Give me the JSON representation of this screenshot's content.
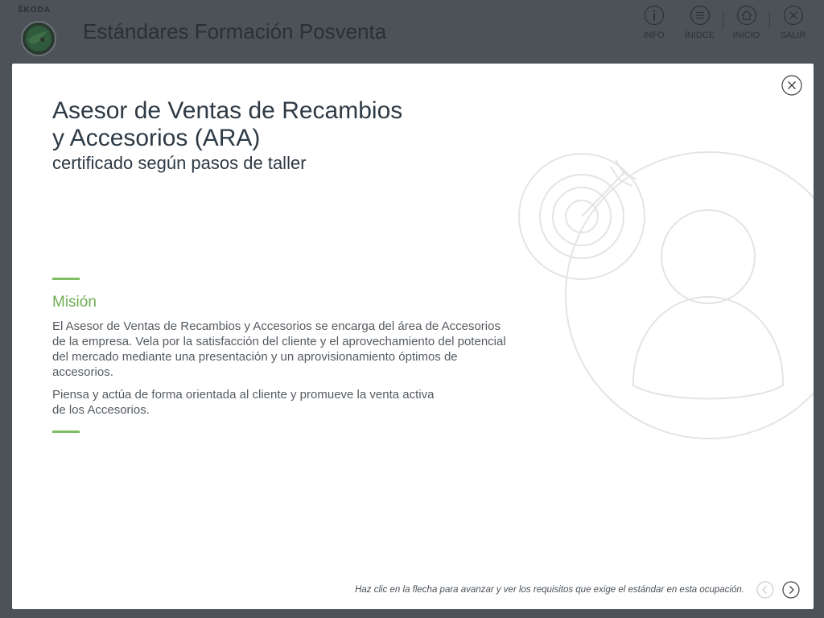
{
  "header": {
    "brand": "ŠKODA",
    "app_title": "Estándares Formación Posventa",
    "nav": [
      {
        "label": "INFO",
        "icon": "info-icon"
      },
      {
        "label": "ÍNIDCE",
        "icon": "list-icon"
      },
      {
        "label": "INICIO",
        "icon": "home-icon"
      },
      {
        "label": "SALIR",
        "icon": "close-icon"
      }
    ]
  },
  "modal": {
    "title_line1": "Asesor de Ventas de Recambios",
    "title_line2": "y Accesorios (ARA)",
    "subtitle": "certificado según pasos de taller",
    "section_title": "Misión",
    "paragraph1": "El Asesor de Ventas de Recambios y Accesorios se encarga del área de Accesorios\nde la empresa. Vela por la satisfacción del cliente y el aprovechamiento del potencial\ndel mercado mediante una presentación y un aprovisionamiento óptimos de\naccesorios.",
    "paragraph2": "Piensa y actúa de forma orientada al cliente y promueve la venta activa\nde los Accesorios.",
    "footer_hint": "Haz clic en la flecha para avanzar y ver los requisitos que exige el estándar en esta ocupación.",
    "illustration": "person-with-target-icon"
  },
  "colors": {
    "accent_green": "#7dbd63",
    "title_text": "#2e3a45",
    "overlay": "#4c5257"
  }
}
